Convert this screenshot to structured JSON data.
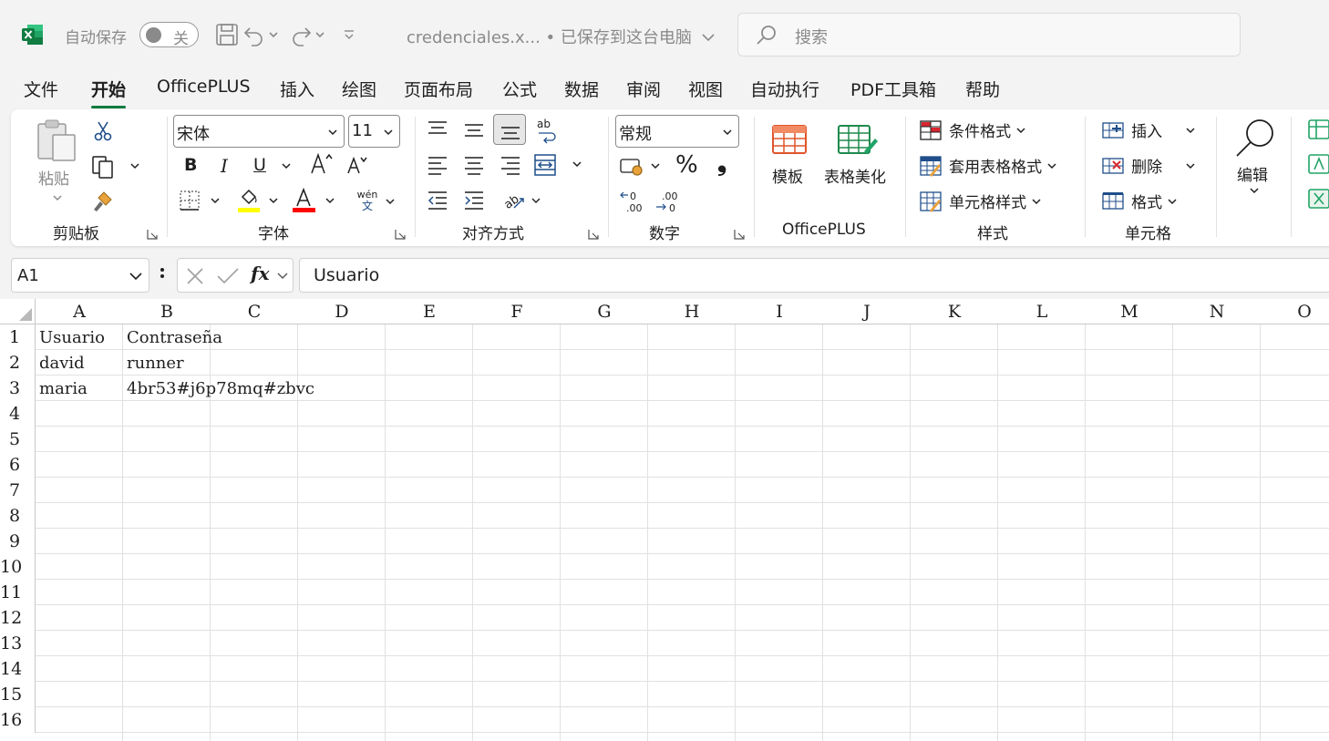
{
  "titlebar": {
    "autosave_label": "自动保存",
    "autosave_state": "关",
    "doc_title": "credenciales.x... • 已保存到这台电脑",
    "search_placeholder": "搜索"
  },
  "menu": {
    "tabs": [
      "文件",
      "开始",
      "OfficePLUS",
      "插入",
      "绘图",
      "页面布局",
      "公式",
      "数据",
      "审阅",
      "视图",
      "自动执行",
      "PDF工具箱",
      "帮助"
    ],
    "active": "开始"
  },
  "ribbon": {
    "clipboard": {
      "paste": "粘贴",
      "label": "剪贴板"
    },
    "font": {
      "name": "宋体",
      "size": "11",
      "label": "字体",
      "bold": "B",
      "italic": "I",
      "underline": "U",
      "phonetic_top": "wén",
      "phonetic_bottom": "文",
      "highlight_color": "#ffff00",
      "font_color": "#ff0000"
    },
    "alignment": {
      "label": "对齐方式"
    },
    "number": {
      "format": "常规",
      "label": "数字",
      "percent": "%",
      "comma": "❟"
    },
    "officeplus": {
      "template": "模板",
      "beautify": "表格美化",
      "label": "OfficePLUS"
    },
    "styles": {
      "conditional": "条件格式",
      "table": "套用表格格式",
      "cell": "单元格样式",
      "label": "样式"
    },
    "cells": {
      "insert": "插入",
      "delete": "删除",
      "format": "格式",
      "label": "单元格"
    },
    "editing": {
      "label": "编辑"
    }
  },
  "formula_bar": {
    "name_box": "A1",
    "fx": "fx",
    "value": "Usuario"
  },
  "sheet": {
    "columns": [
      "A",
      "B",
      "C",
      "D",
      "E",
      "F",
      "G",
      "H",
      "I",
      "J",
      "K",
      "L",
      "M",
      "N",
      "O"
    ],
    "rows": [
      "1",
      "2",
      "3",
      "4",
      "5",
      "6",
      "7",
      "8",
      "9",
      "10",
      "11",
      "12",
      "13",
      "14",
      "15",
      "16"
    ],
    "cells": [
      [
        "Usuario",
        "Contraseña"
      ],
      [
        "david",
        "runner"
      ],
      [
        "maria",
        "4br53#j6p78mq#zbvc"
      ]
    ]
  },
  "colors": {
    "accent": "#107c41"
  }
}
